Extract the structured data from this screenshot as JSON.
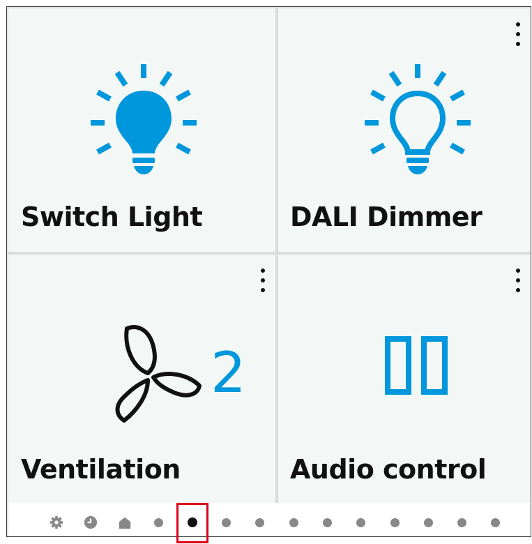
{
  "tiles": [
    {
      "label": "Switch Light",
      "icon": "bulb-filled-icon",
      "has_menu": false
    },
    {
      "label": "DALI Dimmer",
      "icon": "bulb-outline-icon",
      "has_menu": true
    },
    {
      "label": "Ventilation",
      "icon": "fan-icon",
      "level": "2",
      "has_menu": true
    },
    {
      "label": "Audio control",
      "icon": "pause-icon",
      "has_menu": true
    }
  ],
  "nav": {
    "items": [
      "settings-icon",
      "clock-icon",
      "home-icon",
      "page-dot",
      "page-dot-active",
      "page-dot",
      "page-dot",
      "page-dot",
      "page-dot",
      "page-dot",
      "page-dot",
      "page-dot",
      "page-dot",
      "page-dot"
    ],
    "active_index": 4
  },
  "colors": {
    "accent": "#0097dc",
    "tile_bg": "#f3f8f6",
    "divider": "#dcdcdc",
    "inactive_dot": "#888888",
    "highlight": "#e0001a"
  }
}
